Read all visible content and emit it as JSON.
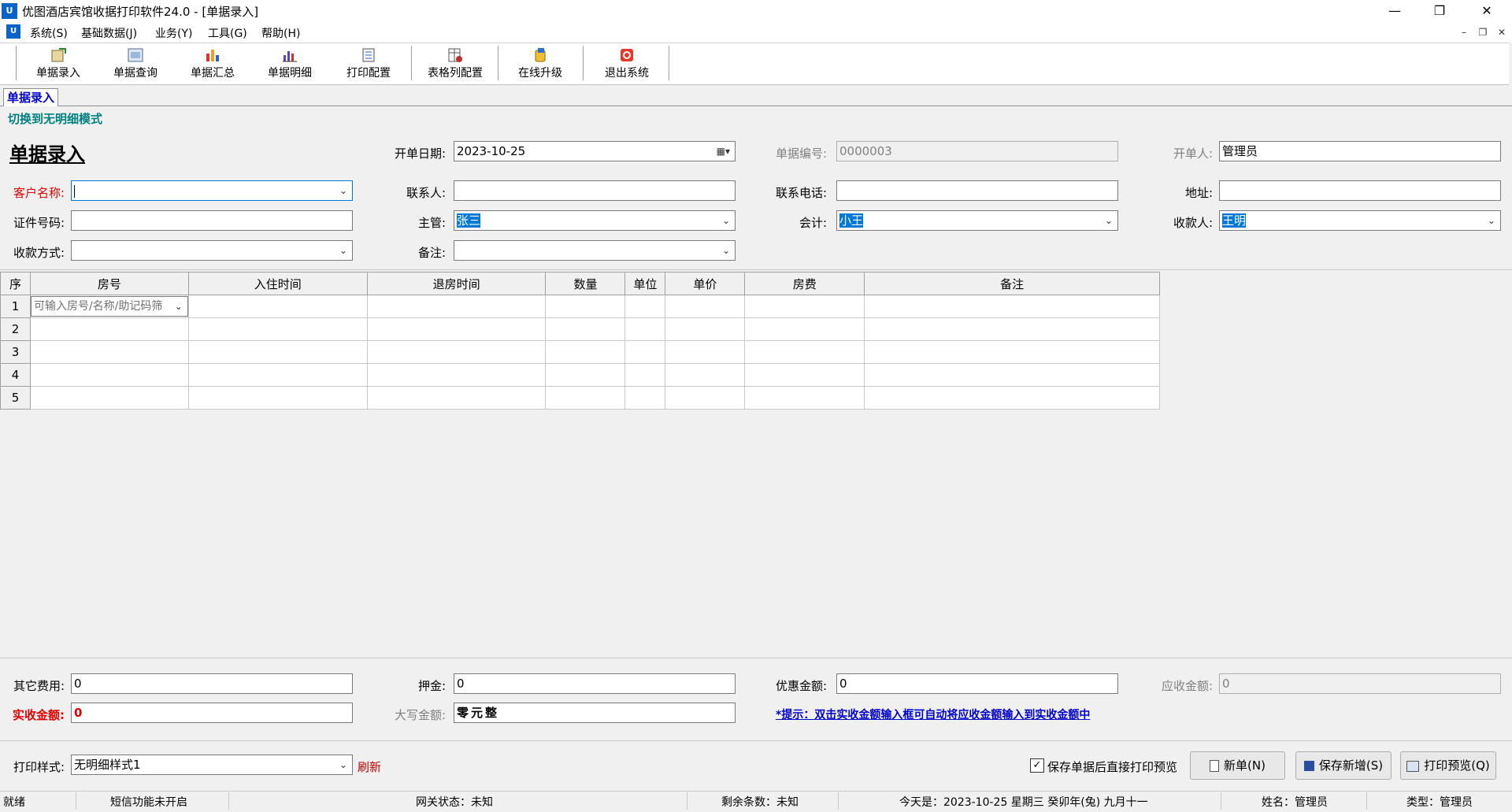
{
  "window": {
    "title": "优图酒店宾馆收据打印软件24.0 - [单据录入]",
    "app_icon_text": "U",
    "controls": {
      "minimize": "—",
      "restore": "❐",
      "close": "✕"
    }
  },
  "menu": {
    "items": [
      "系统(S)",
      "基础数据(J)",
      "业务(Y)",
      "工具(G)",
      "帮助(H)"
    ],
    "mdi_controls": {
      "minimize": "–",
      "restore": "❐",
      "close": "✕"
    }
  },
  "toolbar": {
    "items": [
      {
        "label": "单据录入",
        "icon": "document-entry-icon"
      },
      {
        "label": "单据查询",
        "icon": "document-search-icon"
      },
      {
        "label": "单据汇总",
        "icon": "bar-chart-icon"
      },
      {
        "label": "单据明细",
        "icon": "detail-chart-icon"
      },
      {
        "label": "打印配置",
        "icon": "print-config-icon"
      },
      {
        "label": "表格列配置",
        "icon": "table-config-icon"
      },
      {
        "label": "在线升级",
        "icon": "upgrade-icon"
      },
      {
        "label": "退出系统",
        "icon": "exit-icon"
      }
    ]
  },
  "tabs": {
    "active": "单据录入"
  },
  "mode_link": "切换到无明细模式",
  "form": {
    "title": "单据录入",
    "date_label": "开单日期:",
    "date_value": "2023-10-25",
    "docno_label": "单据编号:",
    "docno_value": "0000003",
    "issuer_label": "开单人:",
    "issuer_value": "管理员",
    "customer_label": "客户名称:",
    "customer_value": "",
    "contact_label": "联系人:",
    "contact_value": "",
    "phone_label": "联系电话:",
    "phone_value": "",
    "address_label": "地址:",
    "address_value": "",
    "id_label": "证件号码:",
    "id_value": "",
    "manager_label": "主管:",
    "manager_value": "张三",
    "accountant_label": "会计:",
    "accountant_value": "小王",
    "payee_label": "收款人:",
    "payee_value": "王明",
    "payment_label": "收款方式:",
    "payment_value": "",
    "remark_label": "备注:",
    "remark_value": ""
  },
  "grid": {
    "columns": [
      "序",
      "房号",
      "入住时间",
      "退房时间",
      "数量",
      "单位",
      "单价",
      "房费",
      "备注"
    ],
    "rows": [
      "1",
      "2",
      "3",
      "4",
      "5"
    ],
    "room_placeholder": "可输入房号/名称/助记码筛"
  },
  "totals": {
    "other_fee_label": "其它费用:",
    "other_fee_value": "0",
    "deposit_label": "押金:",
    "deposit_value": "0",
    "discount_label": "优惠金额:",
    "discount_value": "0",
    "due_label": "应收金额:",
    "due_value": "0",
    "paid_label": "实收金额:",
    "paid_value": "0",
    "capital_label": "大写金额:",
    "capital_value": "零元整",
    "hint": "*提示：双击实收金额输入框可自动将应收金额输入到实收金额中"
  },
  "footer": {
    "print_style_label": "打印样式:",
    "print_style_value": "无明细样式1",
    "refresh": "刷新",
    "preview_checkbox": "保存单据后直接打印预览",
    "new_button": "新单(N)",
    "save_button": "保存新增(S)",
    "print_button": "打印预览(Q)"
  },
  "status": {
    "ready": "就绪",
    "sms": "短信功能未开启",
    "gateway": "网关状态：未知",
    "remaining": "剩余条数：未知",
    "today": "今天是：2023-10-25 星期三 癸卯年(兔) 九月十一",
    "name": "姓名：管理员",
    "type": "类型：管理员"
  },
  "colors": {
    "required": "#e00000",
    "link": "#0000cc",
    "mode_link": "#008080",
    "selection": "#0078d7"
  }
}
